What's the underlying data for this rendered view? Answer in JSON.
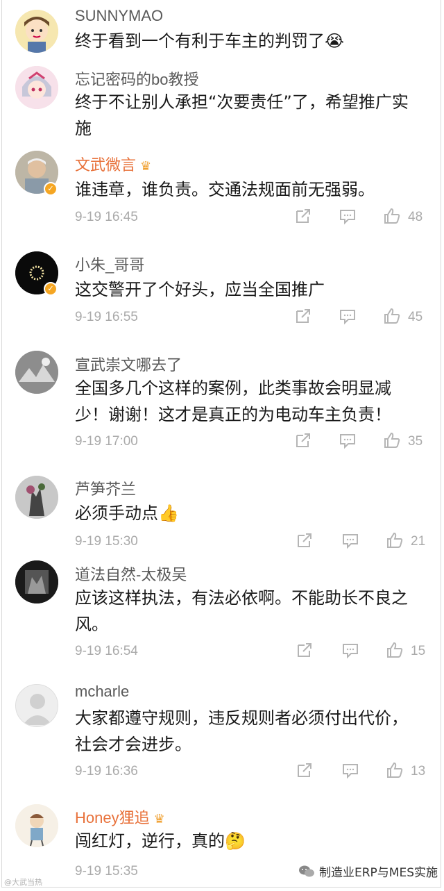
{
  "comments": [
    {
      "user": "SUNNYMAO",
      "text": "终于看到一个有利于车主的判罚了",
      "emoji": "😭",
      "time": "",
      "likes": ""
    },
    {
      "user": "忘记密码的bo教授",
      "text": "终于不让别人承担“次要责任”了，希望推广实施",
      "time": "",
      "likes": ""
    },
    {
      "user": "文武微言",
      "text": "谁违章，谁负责。交通法规面前无强弱。",
      "time": "9-19 16:45",
      "likes": "48"
    },
    {
      "user": "小朱_哥哥",
      "text": "这交警开了个好头，应当全国推广",
      "time": "9-19 16:55",
      "likes": "45"
    },
    {
      "user": "宣武崇文哪去了",
      "text": "全国多几个这样的案例，此类事故会明显减少！谢谢！这才是真正的为电动车主负责！",
      "time": "9-19 17:00",
      "likes": "35"
    },
    {
      "user": "芦笋芥兰",
      "text": "必须手动点",
      "emoji": "👍",
      "time": "9-19 15:30",
      "likes": "21"
    },
    {
      "user": "道法自然-太极吴",
      "text": "应该这样执法，有法必依啊。不能助长不良之风。",
      "time": "9-19 16:54",
      "likes": "15"
    },
    {
      "user": "mcharle",
      "text": "大家都遵守规则，违反规则者必须付出代价，社会才会进步。",
      "time": "9-19 16:36",
      "likes": "13"
    },
    {
      "user": "Honey狸追",
      "text": "闯红灯，逆行，真的",
      "emoji": "🤔",
      "time": "9-19 15:35",
      "likes": ""
    }
  ],
  "watermark": {
    "left": "@大武当热",
    "right": "制造业ERP与MES实施"
  },
  "colors": {
    "vip_name": "#e8713a",
    "verify_badge": "#f5a623",
    "meta_gray": "#aaaaaa"
  },
  "icons": [
    "share-icon",
    "comment-icon",
    "like-icon",
    "verified-icon",
    "crown-icon",
    "wechat-icon"
  ]
}
